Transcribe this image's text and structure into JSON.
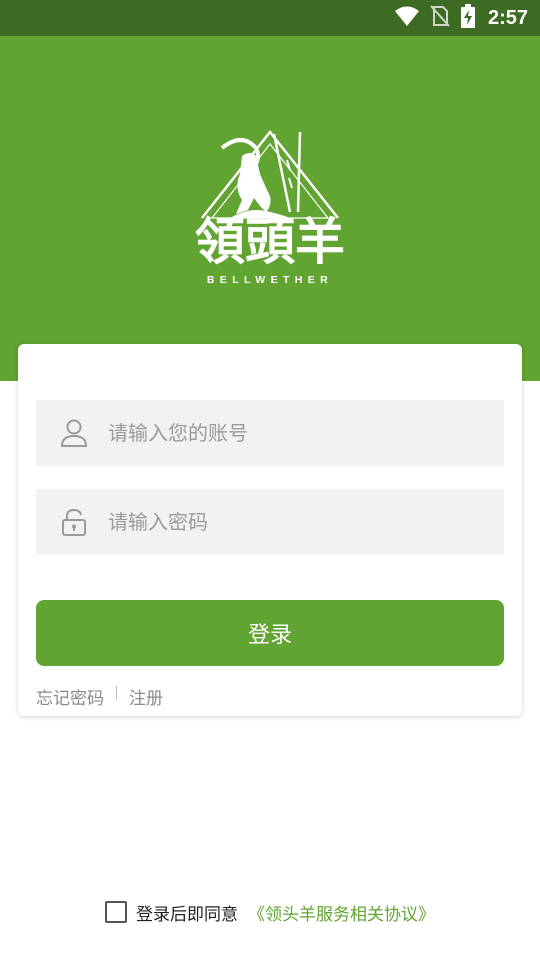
{
  "status_bar": {
    "time": "2:57",
    "icons": [
      "wifi-icon",
      "no-sim-icon",
      "battery-charging-icon"
    ]
  },
  "brand": {
    "name": "領頭羊",
    "subtitle": "BELLWETHER",
    "logo_icon": "goat-mountain-logo"
  },
  "login_form": {
    "account_placeholder": "请输入您的账号",
    "password_placeholder": "请输入密码",
    "account_icon": "user-icon",
    "password_icon": "unlock-icon",
    "login_button": "登录",
    "forgot_password": "忘记密码",
    "register": "注册"
  },
  "agreement": {
    "checked": false,
    "text": "登录后即同意",
    "link": "《领头羊服务相关协议》"
  },
  "colors": {
    "status_bar": "#3d6b23",
    "primary": "#61a431",
    "input_bg": "#f2f2f2"
  }
}
